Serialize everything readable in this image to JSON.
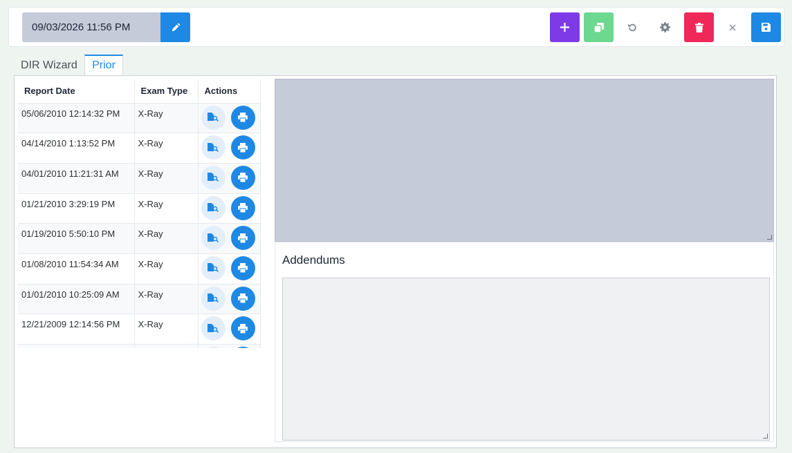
{
  "toolbar": {
    "datetime": "09/03/2026 11:56 PM",
    "buttons": [
      {
        "name": "edit-date-button",
        "icon": "pencil-icon",
        "color": "#1e88e5"
      },
      {
        "name": "add-button",
        "icon": "plus-icon",
        "color": "#7e3ae6"
      },
      {
        "name": "copy-button",
        "icon": "copy-icon",
        "color": "#6cd890"
      },
      {
        "name": "undo-button",
        "icon": "undo-icon",
        "color": "transparent"
      },
      {
        "name": "settings-button",
        "icon": "gear-icon",
        "color": "transparent"
      },
      {
        "name": "delete-button",
        "icon": "trash-icon",
        "color": "#f0285a"
      },
      {
        "name": "close-button",
        "icon": "close-icon",
        "color": "transparent"
      },
      {
        "name": "save-button",
        "icon": "save-icon",
        "color": "#1e88e5"
      }
    ]
  },
  "tabs": [
    {
      "label": "DIR Wizard",
      "active": false
    },
    {
      "label": "Prior",
      "active": true
    }
  ],
  "grid": {
    "columns": [
      "Report Date",
      "Exam Type",
      "Actions"
    ],
    "rows": [
      {
        "date": "05/06/2010 12:14:32 PM",
        "type": "X-Ray"
      },
      {
        "date": "04/14/2010 1:13:52 PM",
        "type": "X-Ray"
      },
      {
        "date": "04/01/2010 11:21:31 AM",
        "type": "X-Ray"
      },
      {
        "date": "01/21/2010 3:29:19 PM",
        "type": "X-Ray"
      },
      {
        "date": "01/19/2010 5:50:10 PM",
        "type": "X-Ray"
      },
      {
        "date": "01/08/2010 11:54:34 AM",
        "type": "X-Ray"
      },
      {
        "date": "01/01/2010 10:25:09 AM",
        "type": "X-Ray"
      },
      {
        "date": "12/21/2009 12:14:56 PM",
        "type": "X-Ray"
      },
      {
        "date": "",
        "type": ""
      }
    ]
  },
  "addendums": {
    "title": "Addendums"
  }
}
